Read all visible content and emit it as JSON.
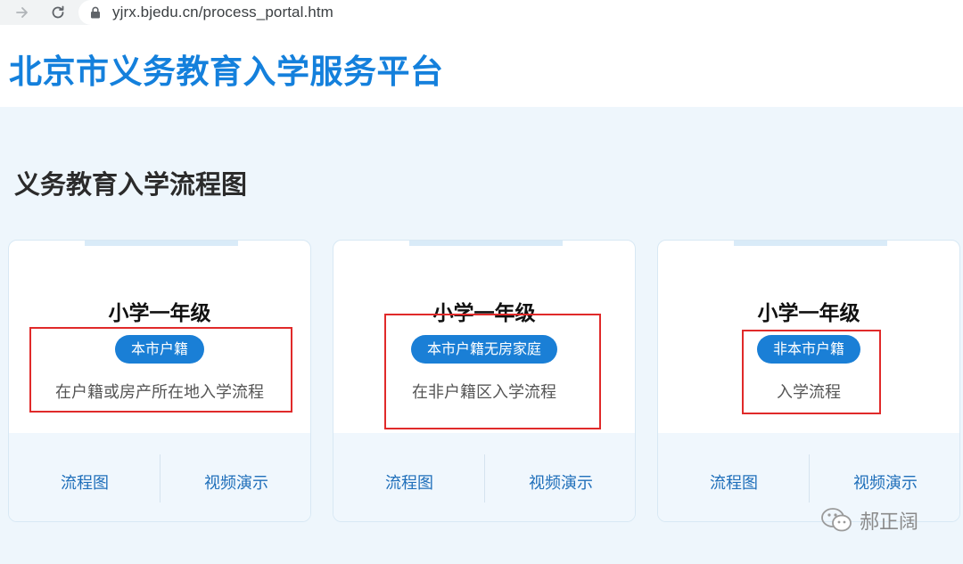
{
  "browser": {
    "url": "yjrx.bjedu.cn/process_portal.htm",
    "icons": [
      "arrow-right-icon",
      "reload-icon",
      "lock-icon"
    ]
  },
  "site": {
    "title": "北京市义务教育入学服务平台",
    "accent_color": "#1480dc"
  },
  "section": {
    "title": "义务教育入学流程图"
  },
  "cards": [
    {
      "title": "小学一年级",
      "badge": "本市户籍",
      "description": "在户籍或房产所在地入学流程",
      "links": [
        "流程图",
        "视频演示"
      ]
    },
    {
      "title": "小学一年级",
      "badge": "本市户籍无房家庭",
      "description": "在非户籍区入学流程",
      "links": [
        "流程图",
        "视频演示"
      ]
    },
    {
      "title": "小学一年级",
      "badge": "非本市户籍",
      "description": "入学流程",
      "links": [
        "流程图",
        "视频演示"
      ]
    }
  ],
  "colors": {
    "badge": "#1a7fd6",
    "link": "#1f6fba",
    "highlight": "#e02a2a",
    "page_background": "#eef6fc"
  },
  "watermark": {
    "text": "郝正阔",
    "icon": "wechat-icon"
  }
}
